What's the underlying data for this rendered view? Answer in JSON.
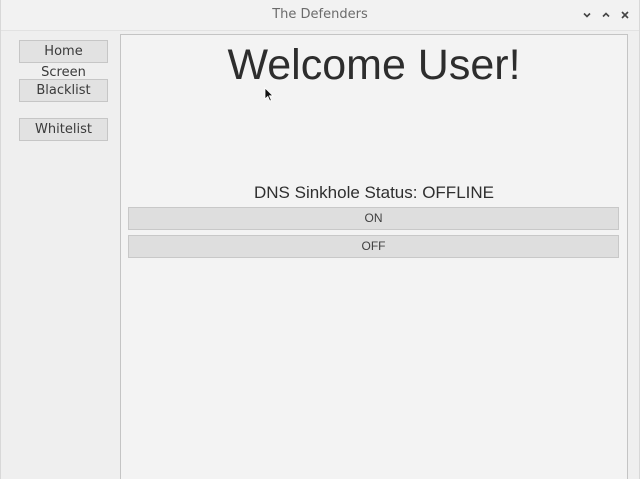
{
  "window": {
    "title": "The Defenders",
    "controls": {
      "minimize_icon": "chevron-down-icon",
      "maximize_icon": "chevron-up-icon",
      "close_icon": "close-icon"
    }
  },
  "sidebar": {
    "items": [
      {
        "label": "Home Screen"
      },
      {
        "label": "Blacklist"
      },
      {
        "label": "Whitelist"
      }
    ]
  },
  "main": {
    "heading": "Welcome User!",
    "status_label": "DNS Sinkhole Status: ",
    "status_value": "OFFLINE",
    "on_button": "ON",
    "off_button": "OFF"
  },
  "colors": {
    "window_bg": "#efefef",
    "button_bg": "#e2e2e2",
    "text": "#2d2d2d"
  }
}
